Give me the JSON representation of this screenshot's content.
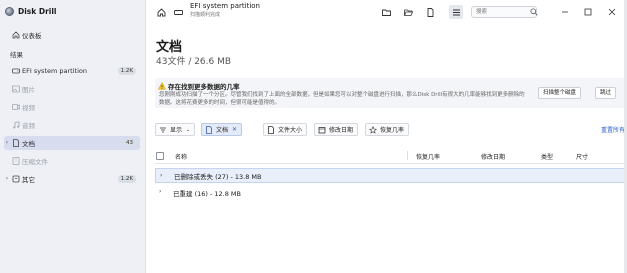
{
  "app": {
    "title": "Disk Drill"
  },
  "sidebar": {
    "dashboard_label": "仪表板",
    "results_label": "结果",
    "items": [
      {
        "label": "EFI system partition",
        "badge": "1.2K",
        "icon": "drive-icon"
      },
      {
        "label": "图片",
        "icon": "image-icon"
      },
      {
        "label": "视频",
        "icon": "video-icon"
      },
      {
        "label": "音频",
        "icon": "audio-icon"
      },
      {
        "label": "文档",
        "badge": "43",
        "icon": "document-icon"
      },
      {
        "label": "压缩文件",
        "icon": "archive-icon"
      },
      {
        "label": "其它",
        "badge": "1.2K",
        "icon": "other-icon"
      }
    ]
  },
  "topbar": {
    "title": "EFI system partition",
    "subtitle": "扫描顺利完成",
    "search_placeholder": "搜索"
  },
  "page": {
    "title": "文档",
    "subtitle": "43文件 / 26.6 MB"
  },
  "banner": {
    "title": "存在找到更多数据的几率",
    "text": "您刚刚成功扫描了一个分区。尽管我们找到了上面的全部数据，但是如果您可以对整个磁盘进行扫描，那么Disk Drill有很大的几率能够找到更多删除的数据。这将花费更多的时间，但很可能是值得的。",
    "scan_button": "扫描整个磁盘",
    "skip_button": "跳过"
  },
  "filters": {
    "show_label": "显示",
    "documents_label": "文档",
    "filesize_label": "文件大小",
    "modified_label": "修改日期",
    "recovery_label": "恢复几率",
    "reset_label": "重置所有"
  },
  "table": {
    "columns": {
      "name": "名称",
      "recovery": "恢复几率",
      "modified": "修改日期",
      "type": "类型",
      "size": "尺寸"
    },
    "rows": [
      {
        "label": "已删除或丢失 (27) - 13.8 MB"
      },
      {
        "label": "已重建 (16) - 12.8 MB"
      }
    ]
  },
  "colors": {
    "accent": "#2f63c9",
    "sidebar_bg": "#eef0f5",
    "selected": "#d7dcef"
  }
}
